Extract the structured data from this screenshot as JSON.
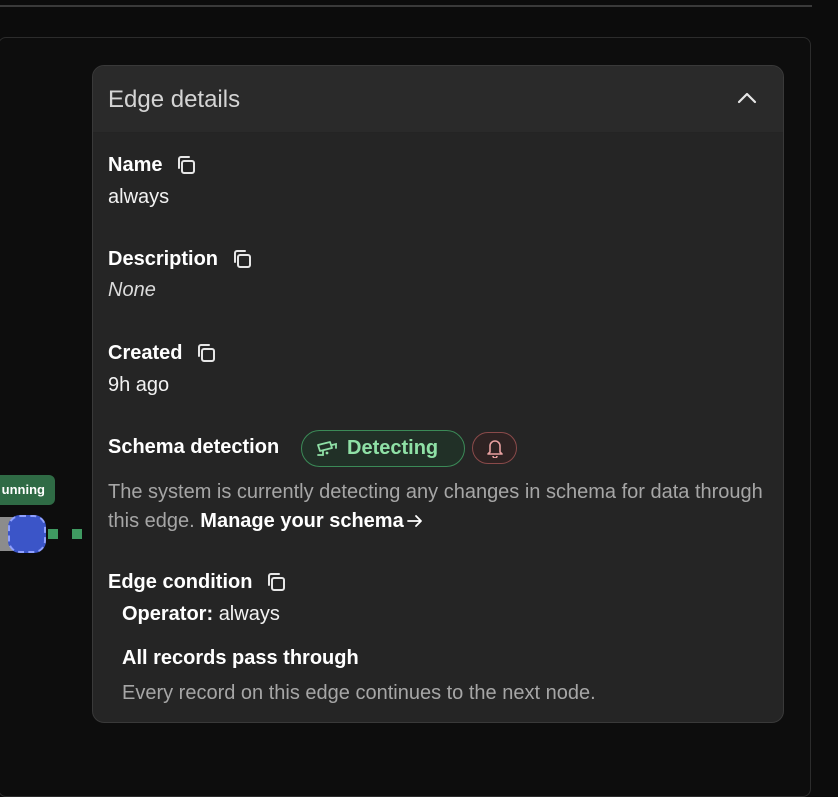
{
  "graph": {
    "node_badge_label": "unning",
    "colors": {
      "badge": "#2f6b45",
      "handle": "#3b55c8",
      "edge": "#3f9a61"
    }
  },
  "panel": {
    "title": "Edge details",
    "collapse_icon": "chevron-up-icon",
    "fields": {
      "name": {
        "label": "Name",
        "value": "always"
      },
      "description": {
        "label": "Description",
        "value": "None"
      },
      "created": {
        "label": "Created",
        "value": "9h ago"
      }
    },
    "schema": {
      "label": "Schema detection",
      "status": "Detecting",
      "status_icon": "camera-detect-icon",
      "alert_icon": "bell-icon",
      "description": "The system is currently detecting any changes in schema for data through this edge. ",
      "link_text": "Manage your schema",
      "link_icon": "arrow-right-icon"
    },
    "condition": {
      "label": "Edge condition",
      "operator_label": "Operator:",
      "operator_value": "always",
      "heading": "All records pass through",
      "description": "Every record on this edge continues to the next node."
    }
  }
}
